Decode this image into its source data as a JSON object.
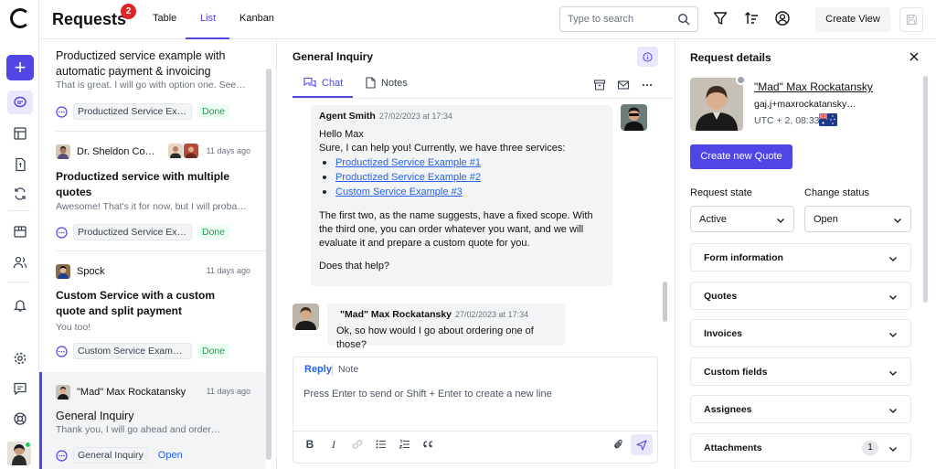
{
  "header": {
    "title": "Requests",
    "badge_count": "2",
    "view_tabs": [
      "Table",
      "List",
      "Kanban"
    ],
    "active_tab": "List",
    "search_placeholder": "Type to search",
    "create_view_label": "Create View"
  },
  "list": {
    "items": [
      {
        "subject": "Productized service example with automatic payment & invoicing",
        "preview": "That is great. I will go with option one. See…",
        "service": "Productized Service Exa…",
        "status": "Done"
      },
      {
        "name": "Dr. Sheldon Co…",
        "time": "11 days ago",
        "subject": "Productized service with multiple quotes",
        "preview": "Awesome! That's it for now, but I will probabl…",
        "service": "Productized Service Exa…",
        "status": "Done"
      },
      {
        "name": "Spock",
        "time": "11 days ago",
        "subject": "Custom Service with a custom quote and split payment",
        "preview": "You too!",
        "service": "Custom Service Example…",
        "status": "Done"
      },
      {
        "name": "\"Mad\" Max Rockatansky",
        "time": "11 days ago",
        "subject": "General Inquiry",
        "preview": "Thank you, I will go ahead and order…",
        "service": "General Inquiry",
        "status": "Open"
      }
    ]
  },
  "chat": {
    "title": "General Inquiry",
    "tabs": [
      "Chat",
      "Notes"
    ],
    "messages": [
      {
        "author": "Agent Smith",
        "time": "27/02/2023 at 17:34",
        "greeting": "Hello Max",
        "intro": "Sure, I can help you! Currently, we have three services:",
        "links": [
          "Productized Service Example #1",
          "Productized Service Example #2",
          "Custom Service Example #3"
        ],
        "body": "The first two, as the name suggests, have a fixed scope. With the third one, you can order whatever you want, and we will evaluate it and prepare a custom quote for you.",
        "closing": "Does that help?"
      },
      {
        "author": "\"Mad\" Max Rockatansky",
        "time": "27/02/2023 at 17:34",
        "text": "Ok, so how would I go about ordering one of those?"
      }
    ],
    "composer": {
      "reply_label": "Reply",
      "note_label": "Note",
      "placeholder": "Press Enter to send or Shift + Enter to create a new line"
    }
  },
  "details": {
    "title": "Request details",
    "customer_name": "\"Mad\" Max Rockatansky",
    "customer_email": "gaj.j+maxrockatansky@…",
    "timezone": "UTC + 2, 08:33",
    "create_quote_label": "Create new Quote",
    "request_state_label": "Request state",
    "request_state_value": "Active",
    "change_status_label": "Change status",
    "change_status_value": "Open",
    "sections": [
      "Form information",
      "Quotes",
      "Invoices",
      "Custom fields",
      "Assignees",
      "Attachments"
    ],
    "attachments_count": "1"
  },
  "colors": {
    "accent": "#4f46e5",
    "badge": "#dc2626",
    "done": "#16a34a",
    "link": "#2563eb"
  }
}
